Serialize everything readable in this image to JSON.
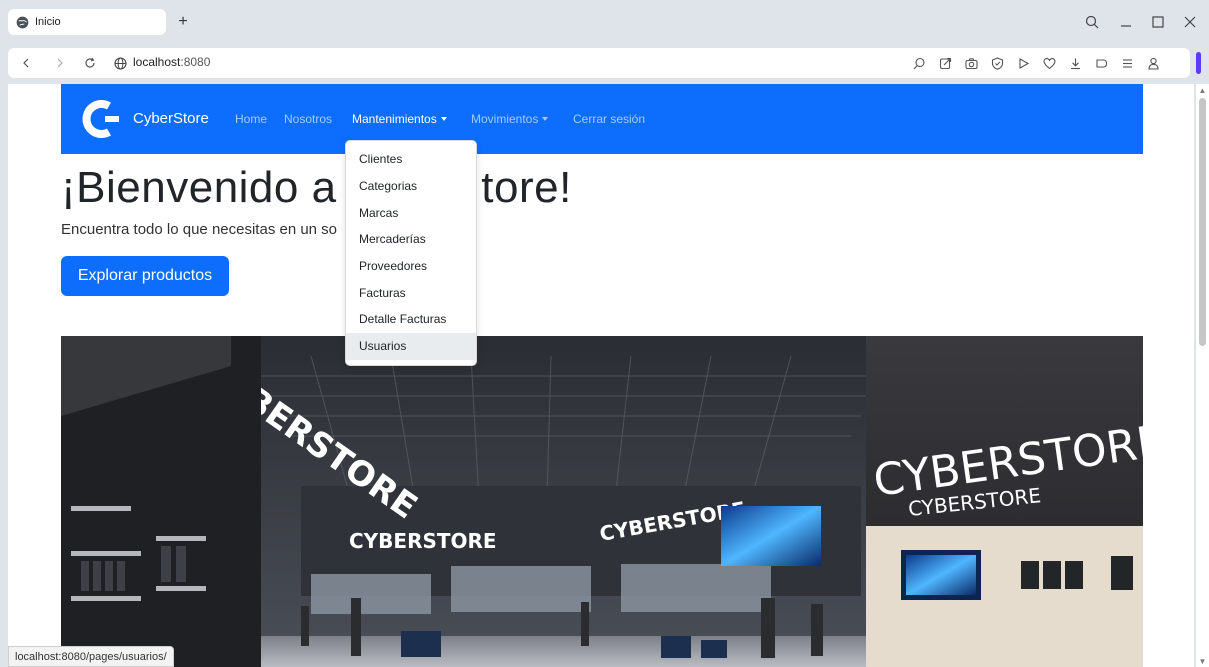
{
  "browser": {
    "tab_title": "Inicio",
    "new_tab_label": "+",
    "url_host": "localhost",
    "url_port": ":8080",
    "status_url": "localhost:8080/pages/usuarios/",
    "toolbar_icons": [
      "search-icon",
      "share-icon",
      "camera-icon",
      "shield-icon",
      "play-icon",
      "heart-icon",
      "download-icon",
      "sidebar-icon",
      "menu-icon",
      "profile-icon"
    ],
    "accent": "#5b3cf0"
  },
  "navbar": {
    "brand": "CyberStore",
    "color": "#0d6efd",
    "links": {
      "home": "Home",
      "nosotros": "Nosotros",
      "mantenimientos": "Mantenimientos",
      "movimientos": "Movimientos",
      "logout": "Cerrar sesión"
    }
  },
  "hero": {
    "title_visible_left": "¡Bienvenido a ",
    "title_visible_right": "tore!",
    "lead": "Encuentra todo lo que necesitas en un so",
    "cta": "Explorar productos"
  },
  "dropdown": {
    "items": [
      "Clientes",
      "Categorias",
      "Marcas",
      "Mercaderías",
      "Proveedores",
      "Facturas",
      "Detalle Facturas",
      "Usuarios"
    ],
    "hovered": "Usuarios"
  },
  "store_image": {
    "signs": [
      "CYBERSTORE",
      "CYBERSTORE",
      "CYBERSTORE",
      "CYBERSTORE",
      "CYBERSTORE"
    ]
  }
}
